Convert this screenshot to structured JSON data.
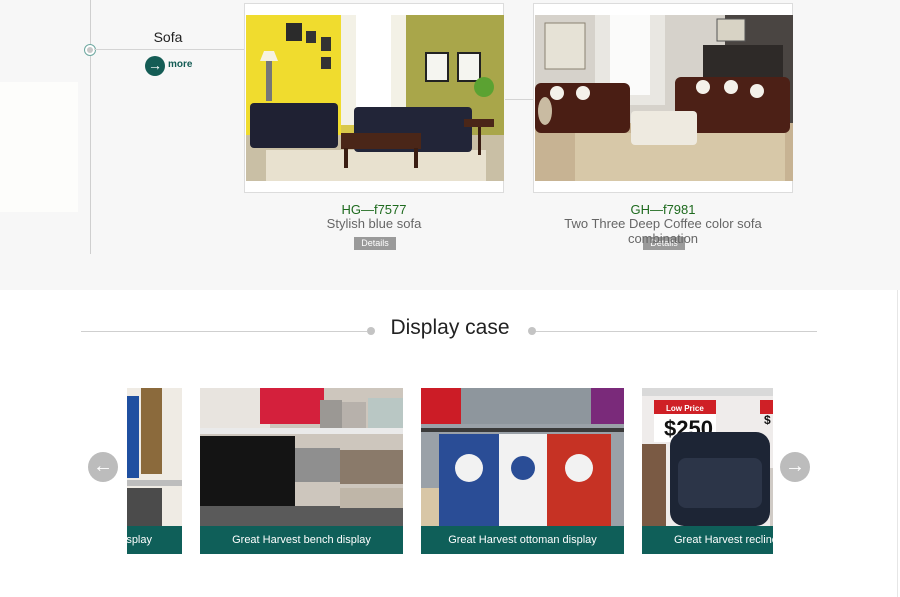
{
  "timeline": {
    "category_title": "Sofa",
    "more_label": "more",
    "more_icon": "→"
  },
  "products": [
    {
      "code": "HG—f7577",
      "name": "Stylish blue sofa",
      "details_label": "Details"
    },
    {
      "code": "GH—f7981",
      "name": "Two Three Deep Coffee color sofa combination",
      "details_label": "Details"
    }
  ],
  "display_case": {
    "title": "Display case",
    "prev_icon": "←",
    "next_icon": "→",
    "items": [
      {
        "caption": "isplay"
      },
      {
        "caption": "Great Harvest bench display"
      },
      {
        "caption": "Great Harvest ottoman display"
      },
      {
        "caption": "Great Harvest recline"
      }
    ]
  },
  "store_signs": {
    "low_price": "Low Price",
    "price": "$250",
    "price_partial": "$"
  },
  "colors": {
    "accent": "#0f5f59",
    "code_green": "#1e6a1e",
    "background_gray": "#f7f7f7"
  }
}
